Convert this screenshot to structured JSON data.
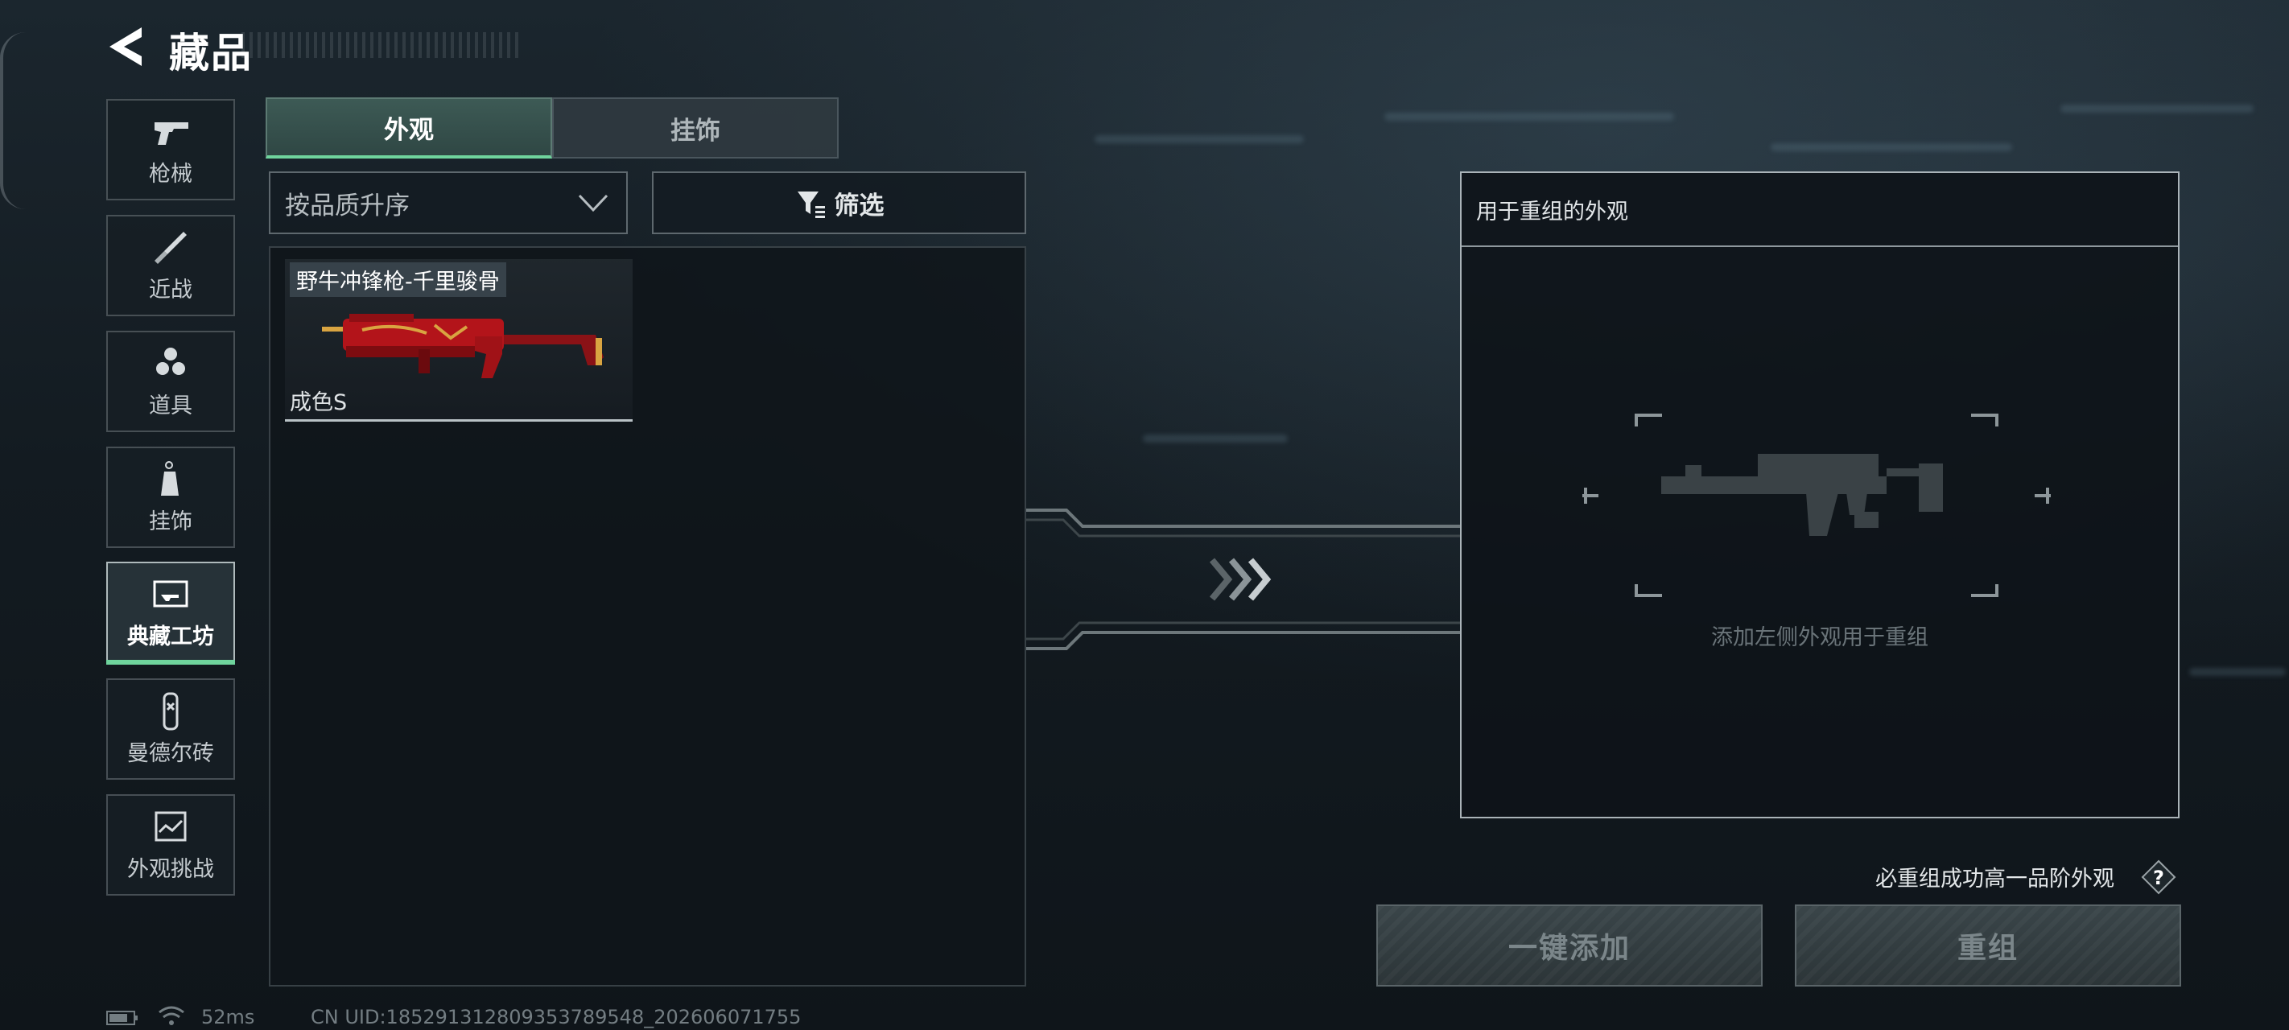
{
  "header": {
    "title": "藏品"
  },
  "sidebar": {
    "items": [
      {
        "label": "枪械",
        "icon": "pistol-icon"
      },
      {
        "label": "近战",
        "icon": "knife-icon"
      },
      {
        "label": "道具",
        "icon": "grenades-icon"
      },
      {
        "label": "挂饰",
        "icon": "charm-icon"
      },
      {
        "label": "典藏工坊",
        "icon": "workshop-icon",
        "active": true
      },
      {
        "label": "曼德尔砖",
        "icon": "mandel-brick-icon"
      },
      {
        "label": "外观挑战",
        "icon": "challenge-icon"
      }
    ]
  },
  "tabs": [
    {
      "label": "外观",
      "active": true
    },
    {
      "label": "挂饰",
      "active": false
    }
  ],
  "sort": {
    "value": "按品质升序"
  },
  "filter": {
    "label": "筛选"
  },
  "items": [
    {
      "name": "野牛冲锋枪-千里骏骨",
      "grade": "成色S"
    }
  ],
  "recombine": {
    "header": "用于重组的外观",
    "hint": "添加左侧外观用于重组",
    "guarantee": "必重组成功高一品阶外观",
    "help": "?",
    "add_button": "一键添加",
    "recombine_button": "重组"
  },
  "status": {
    "ping": "52ms",
    "uid": "CN UID:185291312809353789548_202606071755"
  },
  "colors": {
    "accent": "#6fd49d",
    "item_red": "#b3141a",
    "item_gold": "#d9a441"
  }
}
